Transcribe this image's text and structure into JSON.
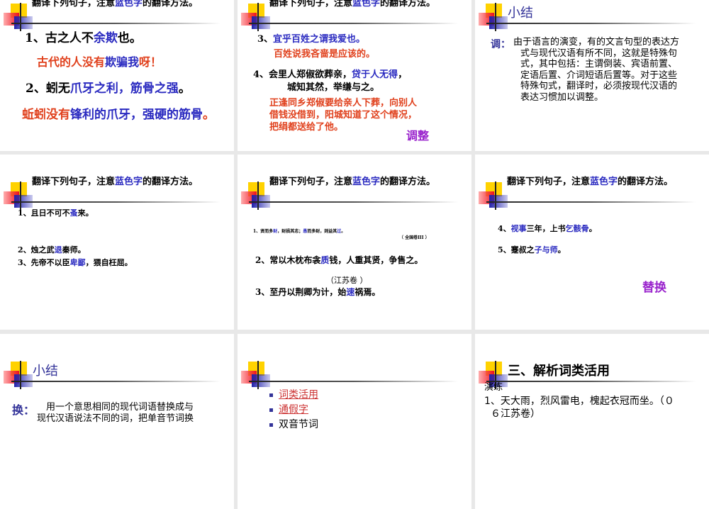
{
  "colors": {
    "k": "#000000",
    "b": "#2a2ac0",
    "r": "#e0401c",
    "p": "#9922cc",
    "navy": "#333399"
  },
  "heading": [
    [
      "翻译下列句子，注意",
      "k"
    ],
    [
      "蓝色字",
      "b"
    ],
    [
      "的翻译方法。",
      "k"
    ]
  ],
  "slides": [
    {
      "lines": [
        [
          [
            "1、古之人不",
            "k"
          ],
          [
            "余欺",
            "b"
          ],
          [
            "也。",
            "k"
          ]
        ],
        [
          [
            "古代的人没有",
            "r"
          ],
          [
            "欺骗我",
            "b"
          ],
          [
            "呀！",
            "r"
          ]
        ],
        [
          [
            "2、蚓无",
            "k"
          ],
          [
            "爪牙之利，筋骨之强",
            "b"
          ],
          [
            "。",
            "k"
          ]
        ],
        [
          [
            "蚯蚓没有",
            "r"
          ],
          [
            "锋利的爪牙，强硬的筋骨",
            "b"
          ],
          [
            "。",
            "r"
          ]
        ]
      ]
    },
    {
      "lines": [
        [
          [
            "3、",
            "k"
          ],
          [
            "宜乎百姓之谓我爱也。",
            "b"
          ]
        ],
        [
          [
            "百姓说我吝啬是应该的。",
            "r"
          ]
        ],
        [
          [
            "4、会里人郑俶欲葬亲，",
            "k"
          ],
          [
            "贷于人无得",
            "b"
          ],
          [
            "，",
            "k"
          ]
        ],
        [
          [
            "城知其然，举缣与之。",
            "k"
          ]
        ],
        [
          [
            "正逢同乡郑俶要给亲人下葬，向别人",
            "r"
          ]
        ],
        [
          [
            "借钱没借到，阳城知道了这个情况，",
            "r"
          ]
        ],
        [
          [
            "把绢都送给了他。",
            "r"
          ]
        ]
      ],
      "label": "调整"
    },
    {
      "title": "小结",
      "term": "调：",
      "para": [
        "由于语言的演变，有的文言句型的表达方",
        "式与现代汉语有所不同，这就是特殊句",
        "式，其中包括：主谓倒装、宾语前置、",
        "定语后置、介词短语后置等。对于这些",
        "特殊句式，翻译时，必须按现代汉语的",
        "表达习惯加以调整。"
      ]
    },
    {
      "lines": [
        [
          [
            "1、且日不可不",
            "k"
          ],
          [
            "蚤",
            "b"
          ],
          [
            "来。",
            "k"
          ]
        ],
        [
          [
            "2、烛之武",
            "k"
          ],
          [
            "退",
            "b"
          ],
          [
            "秦师。",
            "k"
          ]
        ],
        [
          [
            "3、先帝不以臣",
            "k"
          ],
          [
            "卑鄙",
            "b"
          ],
          [
            "，猥自枉屈。",
            "k"
          ]
        ]
      ]
    },
    {
      "lines": [
        [
          [
            "1、贤而多",
            "k"
          ],
          [
            "财",
            "b"
          ],
          [
            "，财损其志；",
            "k"
          ],
          [
            "愚",
            "b"
          ],
          [
            "而多财，则益其",
            "k"
          ],
          [
            "过",
            "b"
          ],
          [
            "。",
            "k"
          ]
        ],
        [
          [
            "（ 全国卷III ）",
            "k"
          ]
        ],
        [
          [
            "2、常以木枕布衾",
            "k"
          ],
          [
            "质",
            "b"
          ],
          [
            "钱，人重其贤，争售之。",
            "k"
          ]
        ],
        [
          [
            "（江苏卷 ）",
            "k"
          ]
        ],
        [
          [
            "3、至丹以荆卿为计，始",
            "k"
          ],
          [
            "速",
            "b"
          ],
          [
            "祸焉。",
            "k"
          ]
        ]
      ]
    },
    {
      "lines": [
        [
          [
            "4、",
            "k"
          ],
          [
            "视事",
            "b"
          ],
          [
            "三年，上书",
            "k"
          ],
          [
            "乞骸骨",
            "b"
          ],
          [
            "。",
            "k"
          ]
        ],
        [
          [
            "5、蹇叔之",
            "k"
          ],
          [
            "子与师",
            "b"
          ],
          [
            "。",
            "k"
          ]
        ]
      ],
      "label": "替换"
    },
    {
      "title": "小结",
      "term": "换：",
      "para": [
        "用一个意思相同的现代词语替换成与",
        "现代汉语说法不同的词，把单音节词换"
      ]
    },
    {
      "bullets": [
        {
          "label": "词类活用",
          "link": true
        },
        {
          "label": "通假字",
          "link": true
        },
        {
          "label": "双音节词",
          "link": false
        }
      ]
    },
    {
      "title": "三、解析词类活用",
      "sub": "演练",
      "para": [
        "1、天大雨，烈风雷电，槐起衣冠而坐。（０",
        "６江苏卷）"
      ]
    }
  ]
}
